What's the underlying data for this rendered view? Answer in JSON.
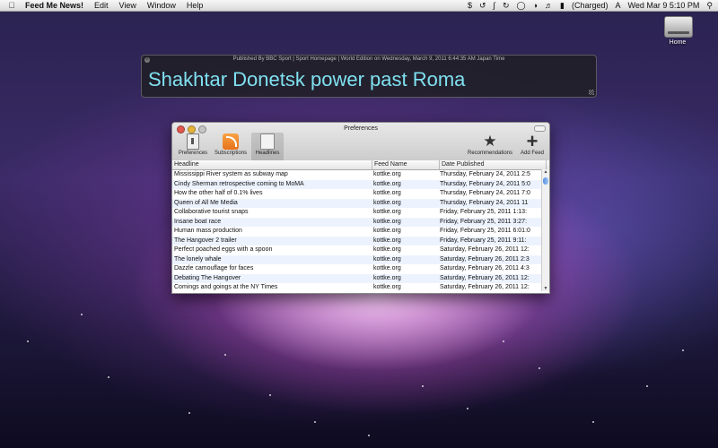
{
  "menubar": {
    "app_name": "Feed Me News!",
    "menus": [
      "Edit",
      "View",
      "Window",
      "Help"
    ],
    "battery_status": "(Charged)",
    "clock": "Wed Mar 9   5:10 PM"
  },
  "desktop": {
    "drive_label": "Home"
  },
  "hud": {
    "published_line": "Published By BBC Sport | Sport Homepage | World Edition on Wednesday, March 9, 2011 6:44:35 AM Japan Time",
    "headline": "Shakhtar Donetsk power past Roma"
  },
  "window": {
    "title": "Preferences",
    "toolbar": {
      "preferences": "Preferences",
      "subscriptions": "Subscriptions",
      "headlines": "Headlines",
      "recommendations": "Recommendations",
      "add_feed": "Add Feed"
    },
    "table": {
      "columns": [
        "Headline",
        "Feed Name",
        "Date Published"
      ],
      "rows": [
        [
          "Mississippi River system as subway map",
          "kottke.org",
          "Thursday, February 24, 2011 2:5"
        ],
        [
          "Cindy Sherman retrospective coming to MoMA",
          "kottke.org",
          "Thursday, February 24, 2011 5:0"
        ],
        [
          "How the other half of 0.1% lives",
          "kottke.org",
          "Thursday, February 24, 2011 7:0"
        ],
        [
          "Queen of All Me Media",
          "kottke.org",
          "Thursday, February 24, 2011 11"
        ],
        [
          "Collaborative tourist snaps",
          "kottke.org",
          "Friday, February 25, 2011 1:13:"
        ],
        [
          "Insane boat race",
          "kottke.org",
          "Friday, February 25, 2011 3:27:"
        ],
        [
          "Human mass production",
          "kottke.org",
          "Friday, February 25, 2011 6:01:0"
        ],
        [
          "The Hangover 2 trailer",
          "kottke.org",
          "Friday, February 25, 2011 9:11:"
        ],
        [
          "Perfect poached eggs with a spoon",
          "kottke.org",
          "Saturday, February 26, 2011 12:"
        ],
        [
          "The lonely whale",
          "kottke.org",
          "Saturday, February 26, 2011 2:3"
        ],
        [
          "Dazzle camouflage for faces",
          "kottke.org",
          "Saturday, February 26, 2011 4:3"
        ],
        [
          "Debating The Hangover",
          "kottke.org",
          "Saturday, February 26, 2011 12:"
        ],
        [
          "Comings and goings at the NY Times",
          "kottke.org",
          "Saturday, February 26, 2011 12:"
        ]
      ]
    }
  }
}
